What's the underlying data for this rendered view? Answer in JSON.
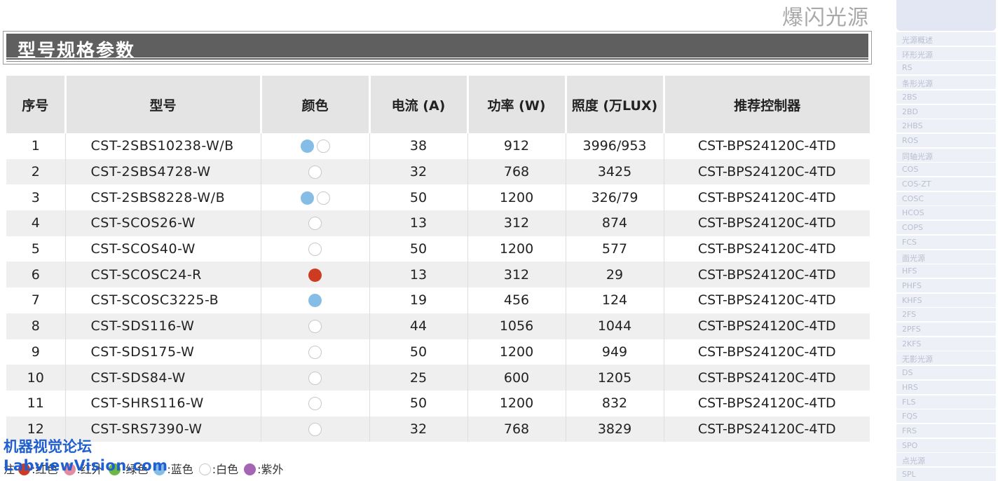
{
  "brand": "爆闪光源",
  "section_title": "型号规格参数",
  "table": {
    "headers": [
      "序号",
      "型号",
      "颜色",
      "电流 (A)",
      "功率 (W)",
      "照度 (万LUX)",
      "推荐控制器"
    ],
    "rows": [
      {
        "no": "1",
        "model": "CST-2SBS10238-W/B",
        "colors": [
          "blue",
          "white"
        ],
        "current": "38",
        "power": "912",
        "lux": "3996/953",
        "controller": "CST-BPS24120C-4TD"
      },
      {
        "no": "2",
        "model": "CST-2SBS4728-W",
        "colors": [
          "white"
        ],
        "current": "32",
        "power": "768",
        "lux": "3425",
        "controller": "CST-BPS24120C-4TD"
      },
      {
        "no": "3",
        "model": "CST-2SBS8228-W/B",
        "colors": [
          "blue",
          "white"
        ],
        "current": "50",
        "power": "1200",
        "lux": "326/79",
        "controller": "CST-BPS24120C-4TD"
      },
      {
        "no": "4",
        "model": "CST-SCOS26-W",
        "colors": [
          "white"
        ],
        "current": "13",
        "power": "312",
        "lux": "874",
        "controller": "CST-BPS24120C-4TD"
      },
      {
        "no": "5",
        "model": "CST-SCOS40-W",
        "colors": [
          "white"
        ],
        "current": "50",
        "power": "1200",
        "lux": "577",
        "controller": "CST-BPS24120C-4TD"
      },
      {
        "no": "6",
        "model": "CST-SCOSC24-R",
        "colors": [
          "red"
        ],
        "current": "13",
        "power": "312",
        "lux": "29",
        "controller": "CST-BPS24120C-4TD"
      },
      {
        "no": "7",
        "model": "CST-SCOSC3225-B",
        "colors": [
          "blue"
        ],
        "current": "19",
        "power": "456",
        "lux": "124",
        "controller": "CST-BPS24120C-4TD"
      },
      {
        "no": "8",
        "model": "CST-SDS116-W",
        "colors": [
          "white"
        ],
        "current": "44",
        "power": "1056",
        "lux": "1044",
        "controller": "CST-BPS24120C-4TD"
      },
      {
        "no": "9",
        "model": "CST-SDS175-W",
        "colors": [
          "white"
        ],
        "current": "50",
        "power": "1200",
        "lux": "949",
        "controller": "CST-BPS24120C-4TD"
      },
      {
        "no": "10",
        "model": "CST-SDS84-W",
        "colors": [
          "white"
        ],
        "current": "25",
        "power": "600",
        "lux": "1205",
        "controller": "CST-BPS24120C-4TD"
      },
      {
        "no": "11",
        "model": "CST-SHRS116-W",
        "colors": [
          "white"
        ],
        "current": "50",
        "power": "1200",
        "lux": "832",
        "controller": "CST-BPS24120C-4TD"
      },
      {
        "no": "12",
        "model": "CST-SRS7390-W",
        "colors": [
          "white"
        ],
        "current": "32",
        "power": "768",
        "lux": "3829",
        "controller": "CST-BPS24120C-4TD"
      }
    ]
  },
  "watermark": {
    "line1": "机器视觉论坛",
    "line2": "LabviewVision.com"
  },
  "legend": {
    "prefix": "注",
    "items": [
      {
        "label": ":红色",
        "color": "#cc3b22"
      },
      {
        "label": ":红外",
        "color": "#e58aa0"
      },
      {
        "label": ":绿色",
        "color": "#6cb844"
      },
      {
        "label": ":蓝色",
        "color": "#86bde6"
      },
      {
        "label": ":白色",
        "color": "#ffffff"
      },
      {
        "label": ":紫外",
        "color": "#a565b5"
      }
    ]
  },
  "color_codes": {
    "blue": "#86bde6",
    "white": "#ffffff",
    "red": "#cc3b22"
  },
  "sidebar": {
    "items": [
      "光源概述",
      "环形光源",
      "RS",
      "条形光源",
      "2BS",
      "2BD",
      "2HBS",
      "ROS",
      "同轴光源",
      "COS",
      "COS-ZT",
      "COSC",
      "HCOS",
      "COPS",
      "FCS",
      "面光源",
      "HFS",
      "PHFS",
      "KHFS",
      "2FS",
      "2PFS",
      "2KFS",
      "无影光源",
      "DS",
      "HRS",
      "FLS",
      "FQS",
      "FRS",
      "SPO",
      "点光源",
      "SPL"
    ]
  }
}
